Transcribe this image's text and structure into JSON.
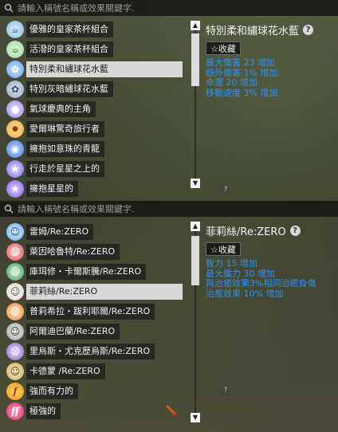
{
  "panel1": {
    "search_placeholder": "請輸入稱號名稱或效果關鍵字.",
    "items": [
      {
        "label": "優雅的皇家茶杯組合",
        "icon": "teacup-icon",
        "color": "#7fb2d8"
      },
      {
        "label": "活潑的皇家茶杯組合",
        "icon": "teacup-icon",
        "color": "#8fd08a"
      },
      {
        "label": "特別柔和繡球花水藍",
        "icon": "hydrangea-blue-icon",
        "color": "#5aa0e8"
      },
      {
        "label": "特別灰暗繡球花水藍",
        "icon": "hydrangea-gray-icon",
        "color": "#8aa4c8"
      },
      {
        "label": "氣球慶典的主角",
        "icon": "balloon-icon",
        "color": "#9a7de8"
      },
      {
        "label": "愛爾琳驚奇旅行者",
        "icon": "sun-icon",
        "color": "#e8a23a"
      },
      {
        "label": "擁抱如意珠的青龍",
        "icon": "dragon-orb-icon",
        "color": "#4a7fd8"
      },
      {
        "label": "行走於星星之上的",
        "icon": "star-orb-icon",
        "color": "#5a6ae8"
      },
      {
        "label": "擁抱星星的",
        "icon": "star-orb-icon",
        "color": "#7a5ae8"
      }
    ],
    "selected_index": 2,
    "detail": {
      "title": "特別柔和繡球花水藍",
      "fav": "☆收藏",
      "stats": [
        "最大傷害 23 增加",
        "額外傷害 1% 增加",
        "幸運 20 增加",
        "移動速度 3% 增加"
      ]
    }
  },
  "panel2": {
    "search_placeholder": "請輸入稱號名稱或效果關鍵字.",
    "items": [
      {
        "label": "雷姆/Re:ZERO",
        "icon": "rem-avatar-icon",
        "color": "#5aa8e8"
      },
      {
        "label": "萊因哈魯特/Re:ZERO",
        "icon": "reinhard-avatar-icon",
        "color": "#d84a4a"
      },
      {
        "label": "庫珥修・卡爾斯騰/Re:ZERO",
        "icon": "crusch-avatar-icon",
        "color": "#3a9a5a"
      },
      {
        "label": "菲莉絲/Re:ZERO",
        "icon": "felix-avatar-icon",
        "color": "#d8d0c0"
      },
      {
        "label": "普莉希拉・跋利耶爾/Re:ZERO",
        "icon": "priscilla-avatar-icon",
        "color": "#e88a3a"
      },
      {
        "label": "阿爾迪巴蘭/Re:ZERO",
        "icon": "al-avatar-icon",
        "color": "#c8c8c8"
      },
      {
        "label": "里烏斯・尤克歷烏斯/Re:ZERO",
        "icon": "julius-avatar-icon",
        "color": "#8a6ac8"
      },
      {
        "label": "卡德蒙 /Re:ZERO",
        "icon": "kadomon-avatar-icon",
        "color": "#c8a85a"
      },
      {
        "label": "強而有力的",
        "icon": "strength-icon",
        "color": "#e89a1a"
      },
      {
        "label": "極強的",
        "icon": "strength-icon",
        "color": "#d82a6a"
      }
    ],
    "selected_index": 3,
    "detail": {
      "title": "菲莉絲/Re:ZERO",
      "fav": "☆收藏",
      "stats": [
        "智力 15 增加",
        "最大魔力 30 增加",
        "與治癒效果3%相同治癒負傷",
        "治癒效果 10% 增加"
      ]
    }
  },
  "scroll_up": "▲",
  "scroll_down": "▼",
  "help": "?"
}
